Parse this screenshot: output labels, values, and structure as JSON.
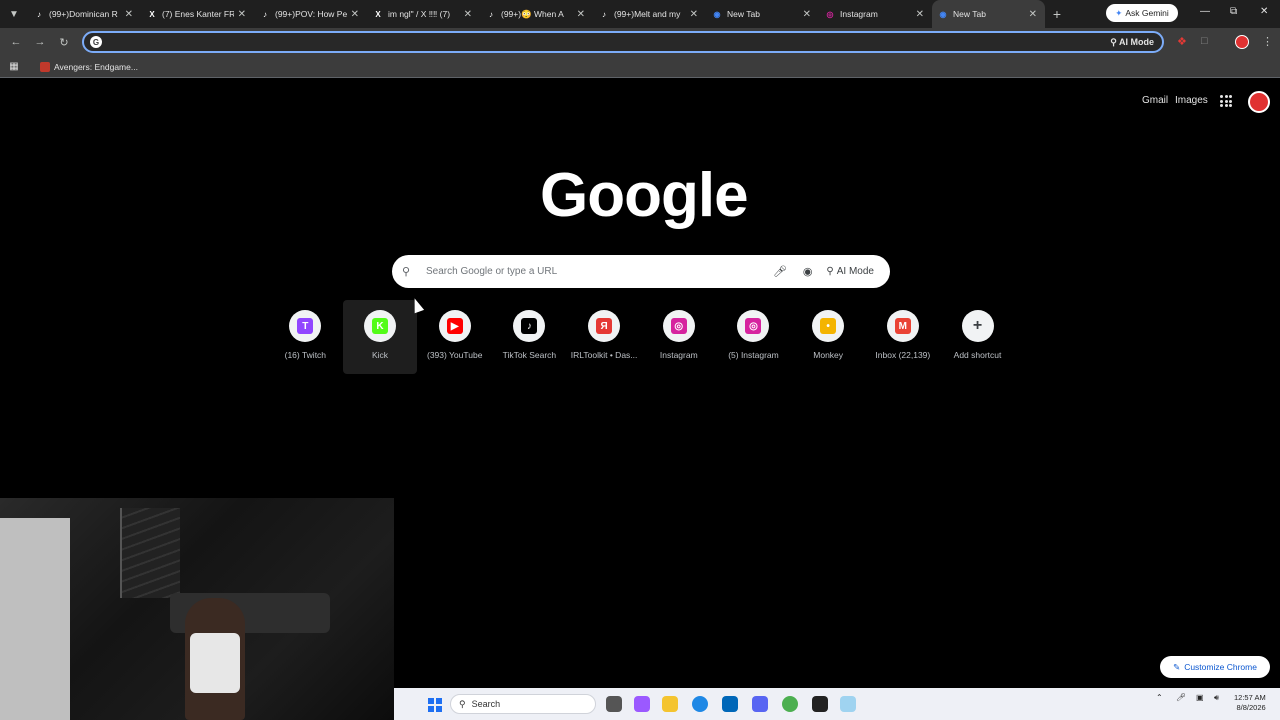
{
  "tabs": [
    {
      "title": "(99+)Dominican R",
      "favicon": "tiktok-icon"
    },
    {
      "title": "(7) Enes Kanter FR",
      "favicon": "x-icon"
    },
    {
      "title": "(99+)POV: How Pe",
      "favicon": "tiktok-icon"
    },
    {
      "title": "im ngl\" / X ‼‼ (7)",
      "favicon": "x-icon"
    },
    {
      "title": "(99+)😳 When A",
      "favicon": "tiktok-icon"
    },
    {
      "title": "(99+)Melt and my",
      "favicon": "tiktok-icon"
    },
    {
      "title": "New Tab",
      "favicon": "chrome-icon"
    },
    {
      "title": "Instagram",
      "favicon": "instagram-icon"
    },
    {
      "title": "New Tab",
      "favicon": "chrome-icon",
      "active": true
    }
  ],
  "ask_gemini": "Ask Gemini",
  "omnibox": {
    "value": "",
    "ai_mode": "AI Mode"
  },
  "bookmarks": [
    {
      "label": "Avengers: Endgame..."
    }
  ],
  "header": {
    "gmail": "Gmail",
    "images": "Images"
  },
  "logo": "Google",
  "search": {
    "placeholder": "Search Google or type a URL",
    "ai_mode": "AI Mode"
  },
  "shortcuts": [
    {
      "label": "(16) Twitch",
      "color": "#9146ff",
      "glyph": "T"
    },
    {
      "label": "Kick",
      "color": "#53fc18",
      "glyph": "K"
    },
    {
      "label": "(393) YouTube",
      "color": "#ff0000",
      "glyph": "▶"
    },
    {
      "label": "TikTok Search",
      "color": "#000000",
      "glyph": "♪"
    },
    {
      "label": "IRLToolkit • Das...",
      "color": "#e53935",
      "glyph": "Я"
    },
    {
      "label": "Instagram",
      "color": "#d6249f",
      "glyph": "◎"
    },
    {
      "label": "(5) Instagram",
      "color": "#d6249f",
      "glyph": "◎"
    },
    {
      "label": "Monkey",
      "color": "#f4b400",
      "glyph": "•"
    },
    {
      "label": "Inbox (22,139)",
      "color": "#ea4335",
      "glyph": "M"
    },
    {
      "label": "Add shortcut",
      "color": "#3c4043",
      "glyph": "+"
    }
  ],
  "customize": "Customize Chrome",
  "taskbar": {
    "search_placeholder": "Search",
    "time": "12:57 AM",
    "date": "8/8/2026"
  }
}
